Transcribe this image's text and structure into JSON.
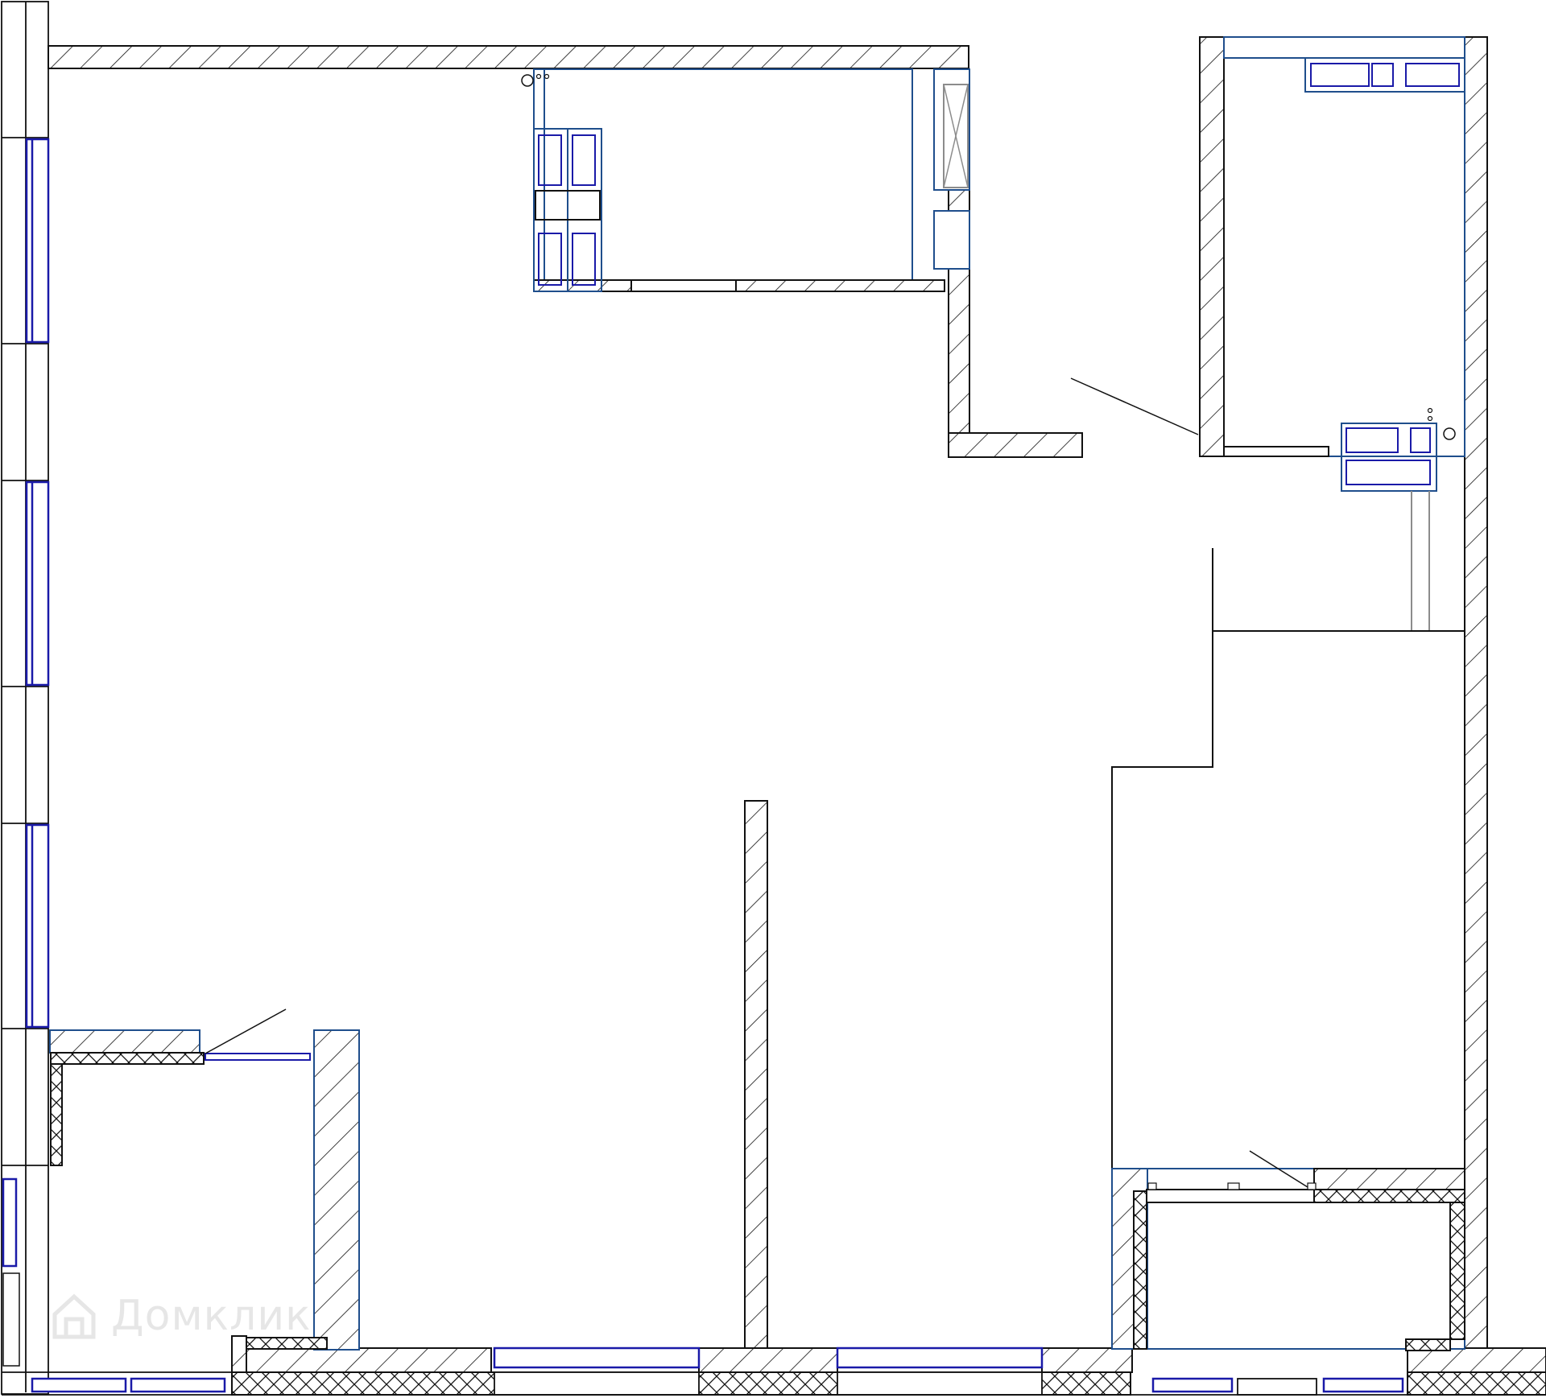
{
  "plan": {
    "type": "apartment floor plan",
    "colors": {
      "wall_stroke": "#111111",
      "outline_blue": "#1f4e8c",
      "glass_navy": "#1a1aa8",
      "fixture_grey": "#8c8c8c",
      "background": "#ffffff"
    }
  },
  "watermark": {
    "text": "Домклик",
    "icon": "house-logo-icon"
  }
}
